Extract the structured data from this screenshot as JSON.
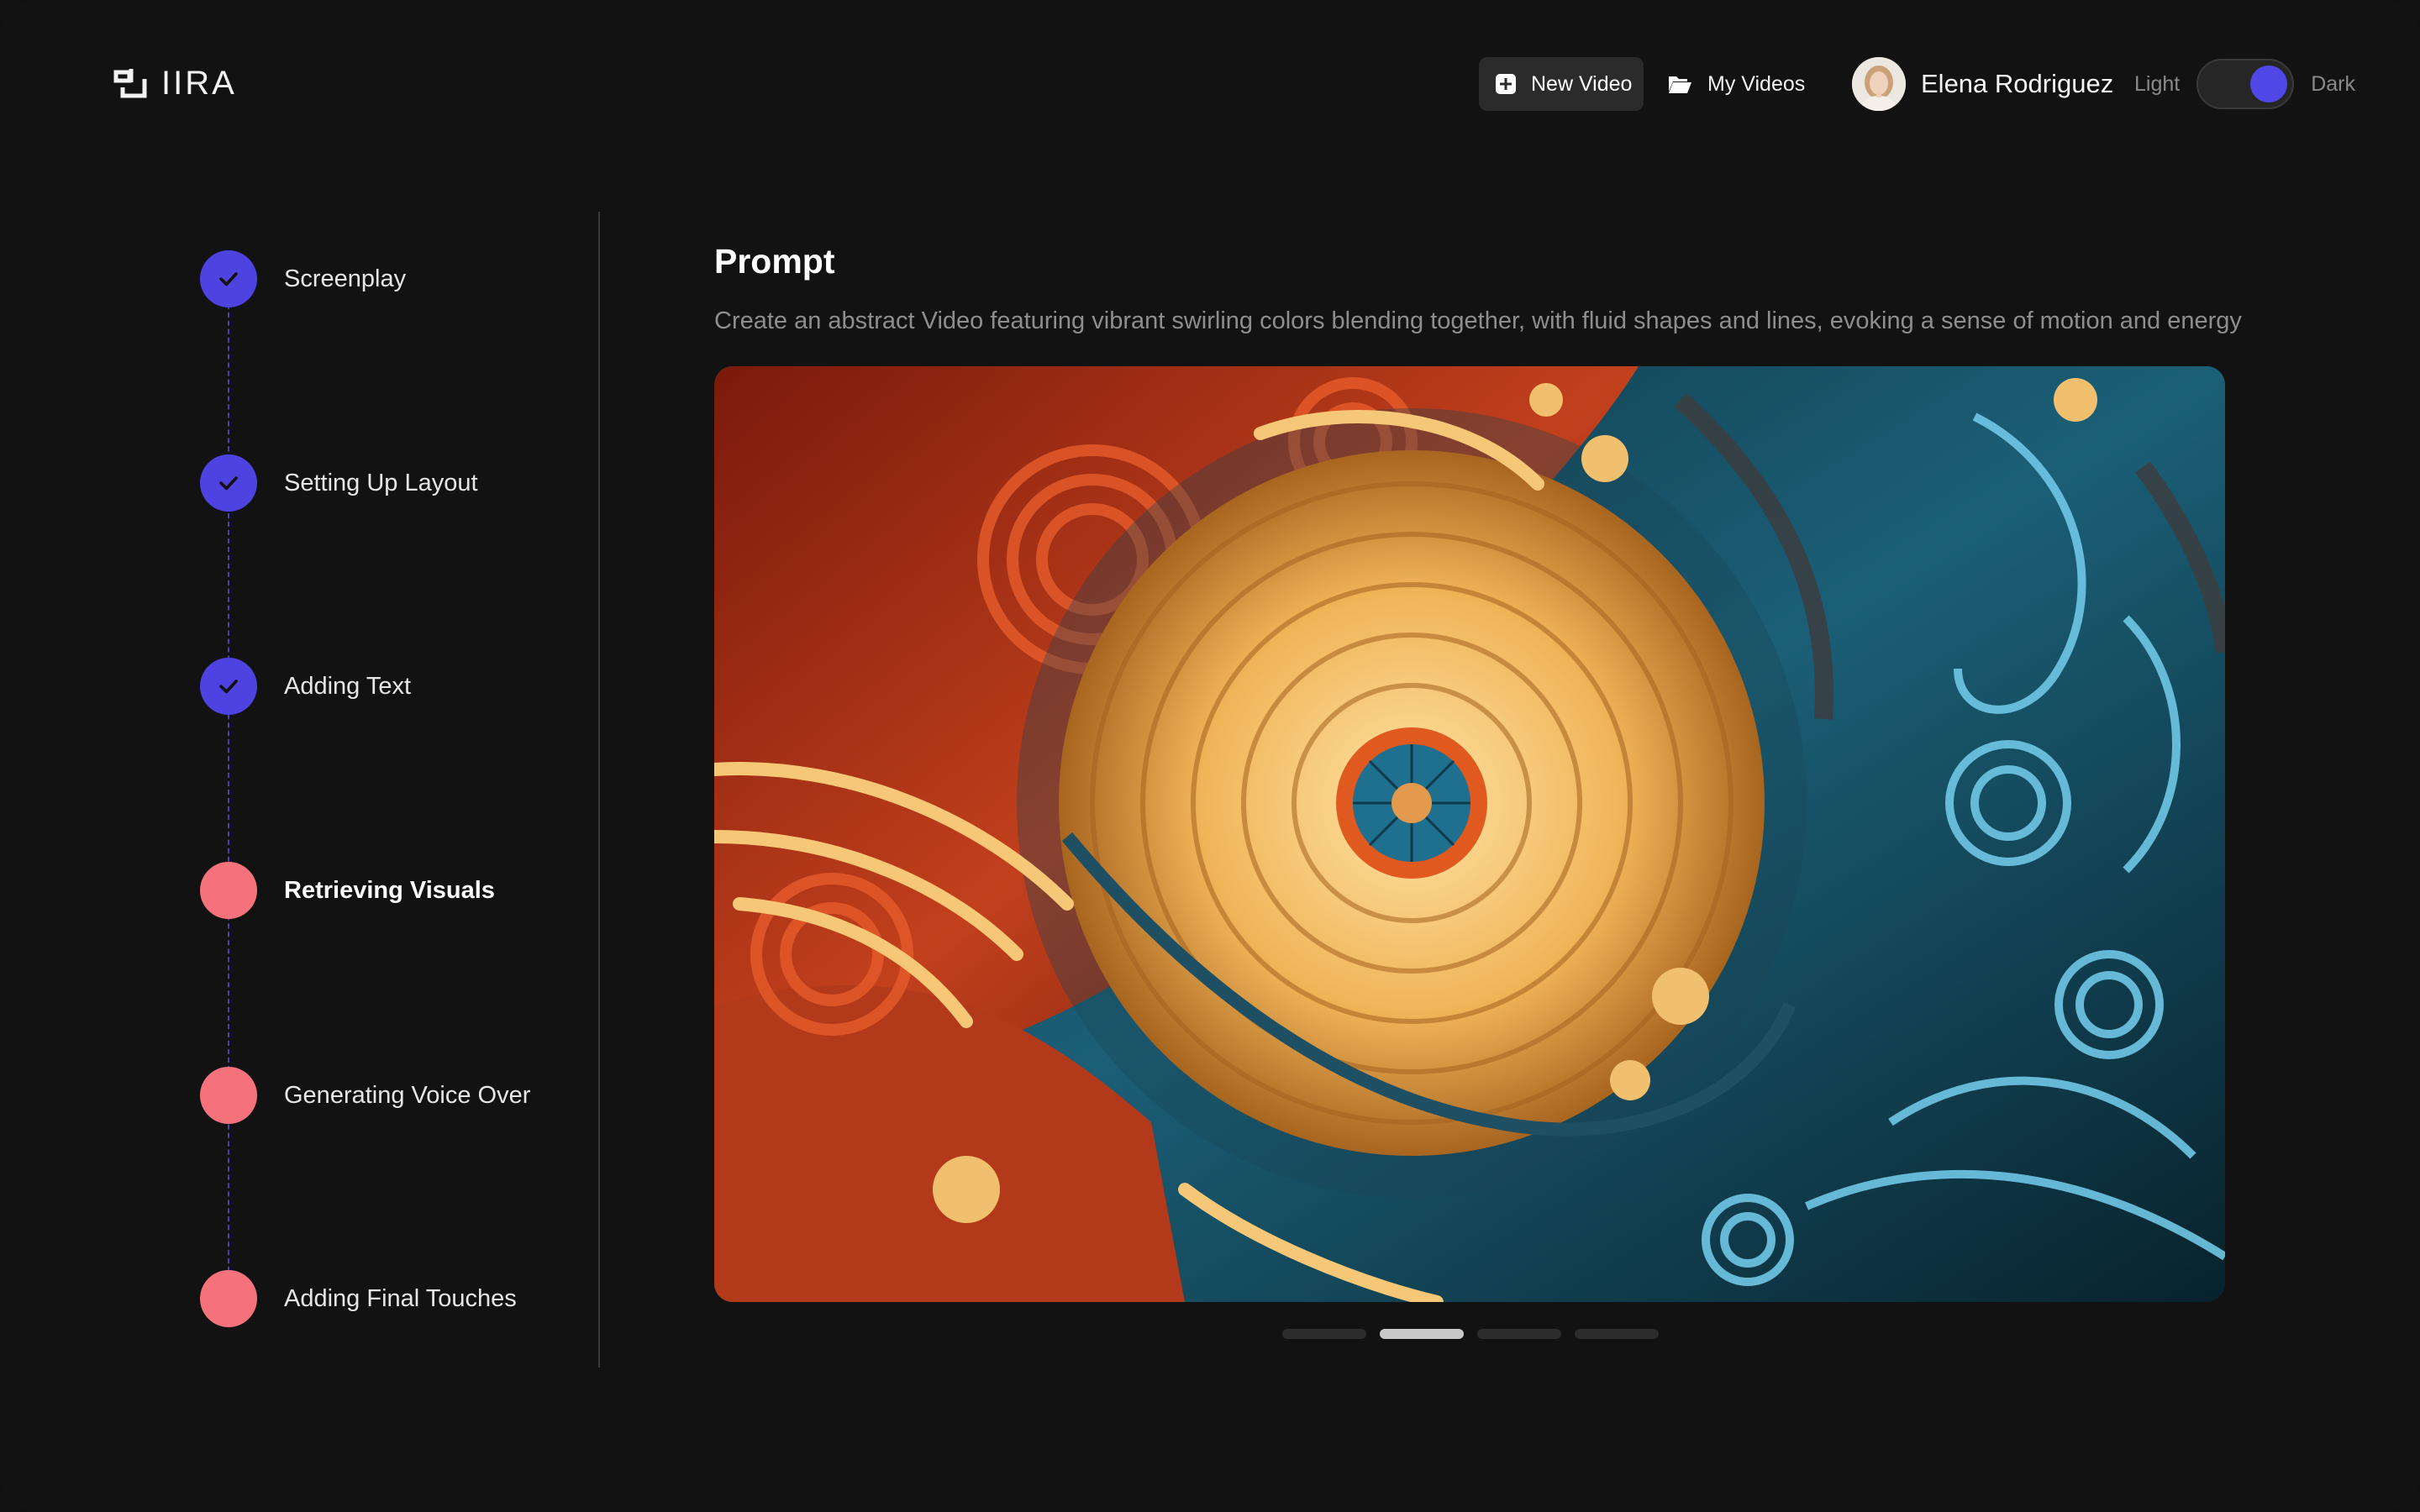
{
  "app": {
    "logo_text": "IIRA"
  },
  "header": {
    "new_video_label": "New Video",
    "my_videos_label": "My Videos",
    "user_name": "Elena Rodriguez",
    "theme_light_label": "Light",
    "theme_dark_label": "Dark",
    "theme_selected": "Dark"
  },
  "steps": [
    {
      "label": "Screenplay",
      "status": "done"
    },
    {
      "label": "Setting Up Layout",
      "status": "done"
    },
    {
      "label": "Adding Text",
      "status": "done"
    },
    {
      "label": "Retrieving Visuals",
      "status": "active"
    },
    {
      "label": "Generating Voice Over",
      "status": "pending"
    },
    {
      "label": "Adding Final Touches",
      "status": "pending"
    }
  ],
  "main": {
    "prompt_title": "Prompt",
    "prompt_text": "Create an abstract Video featuring vibrant swirling colors blending together, with fluid shapes and lines, evoking a sense of motion and energy",
    "carousel_count": 4,
    "carousel_active_index": 1
  },
  "colors": {
    "background": "#121212",
    "accent_purple": "#4e43e0",
    "pending_pink": "#f5727c",
    "toggle_knob": "#5146e6"
  },
  "icons": {
    "new_video": "plus-square-icon",
    "my_videos": "folder-open-icon",
    "step_done": "check-icon"
  }
}
